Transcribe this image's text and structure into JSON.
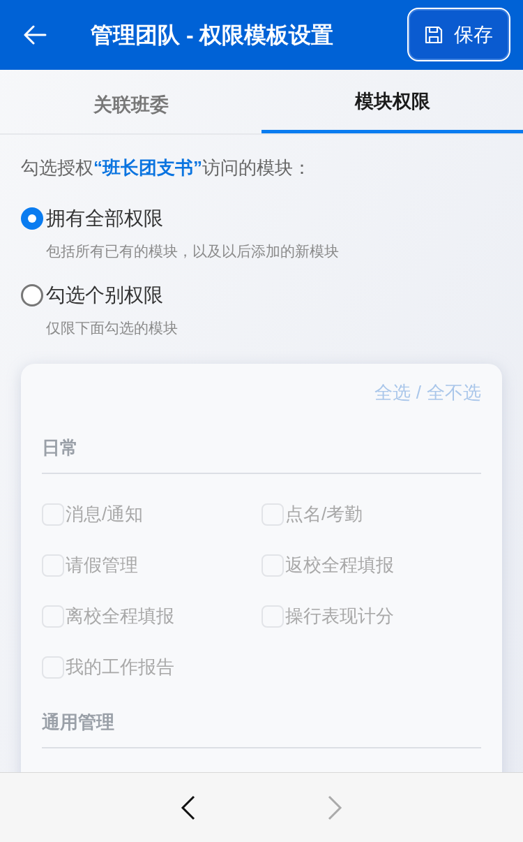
{
  "header": {
    "title": "管理团队 - 权限模板设置",
    "save_button": "保存"
  },
  "tabs": [
    {
      "label": "关联班委",
      "selected": false
    },
    {
      "label": "模块权限",
      "selected": true
    }
  ],
  "prompt": {
    "before": "勾选授权",
    "highlight": "“班长团支书”",
    "after": "访问的模块："
  },
  "scope_options": [
    {
      "label": "拥有全部权限",
      "description": "包括所有已有的模块，以及以后添加的新模块",
      "selected": true
    },
    {
      "label": "勾选个别权限",
      "description": "仅限下面勾选的模块",
      "selected": false
    }
  ],
  "modules_panel": {
    "disabled": true,
    "select_all": "全选",
    "separator": "/",
    "select_none": "全不选",
    "groups": [
      {
        "title": "日常",
        "items": [
          {
            "label": "消息/通知",
            "checked": false
          },
          {
            "label": "点名/考勤",
            "checked": false
          },
          {
            "label": "请假管理",
            "checked": false
          },
          {
            "label": "返校全程填报",
            "checked": false
          },
          {
            "label": "离校全程填报",
            "checked": false
          },
          {
            "label": "操行表现计分",
            "checked": false
          },
          {
            "label": "我的工作报告",
            "checked": false
          }
        ]
      },
      {
        "title": "通用管理"
      }
    ]
  },
  "bottom_nav": {
    "back_disabled": false,
    "forward_disabled": true
  }
}
